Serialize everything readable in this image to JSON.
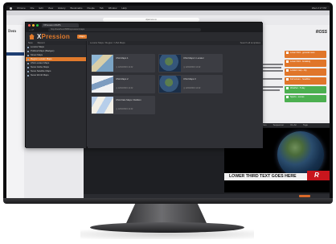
{
  "menubar": {
    "items": [
      "Chrome",
      "File",
      "Edit",
      "View",
      "History",
      "Bookmarks",
      "People",
      "Tab",
      "Window",
      "Help"
    ],
    "clock": "Wed 2:17 PM"
  },
  "background_browser": {
    "url": "dpamos.io",
    "logo": "Dem",
    "brand": "ROSS",
    "news_rows": [
      "Lower third - general news",
      "Lower third - breaking",
      "Locator map - city",
      "Full screen - headline",
      "Weather - 5 day",
      "Sports - scores"
    ]
  },
  "xpression": {
    "tab_title": "XPression MAPS",
    "address": "http://localhost:8080/xpression/maps",
    "brand_x": "X",
    "brand_rest": "Pression",
    "badge": "Maps",
    "sidebar": {
      "head_tabs": [
        "New",
        "Recent"
      ],
      "items": [
        "Locator Maps",
        "Political Maps (Badges)",
        "Street Maps",
        "Region Locator Maps",
        "USA Locator Maps",
        "News Globe Maps",
        "News Satellite Maps",
        "News World Maps"
      ],
      "active_index": 3
    },
    "content_bar": {
      "left": "Locator Maps / Region / USA Maps",
      "right": "Search all templates"
    },
    "cards": [
      {
        "title": "USA Maps 1",
        "meta": "◷  12/18/2019 14:42",
        "thumb": "map-na"
      },
      {
        "title": "USA Maps 1 Locator",
        "meta": "◷  12/18/2019 14:42",
        "thumb": "map-globe"
      },
      {
        "title": "USA Maps 2",
        "meta": "◷  12/18/2019 14:42",
        "thumb": "map-flat"
      },
      {
        "title": "USA Maps 3",
        "meta": "◷  12/18/2019 14:42",
        "thumb": "map-globe"
      },
      {
        "title": "USA Flats Maps 3 Edition",
        "meta": "◷  12/18/2019 14:42",
        "thumb": "map-world"
      }
    ]
  },
  "studio": {
    "tabs": [
      "Basic",
      "Properties",
      "Sequencer",
      "On Air",
      "Tags"
    ],
    "list": [
      "Layer 1 Texture",
      "LOWER THIRD TEXT 001"
    ],
    "lower_third_text": "LOWER THIRD TEXT GOES HERE",
    "logo_letter": "R"
  }
}
